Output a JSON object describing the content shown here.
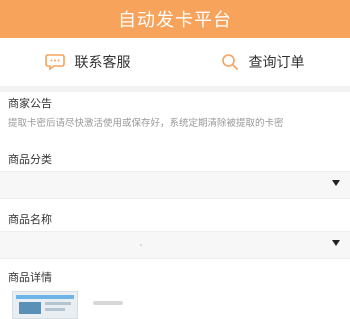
{
  "header": {
    "title": "自动发卡平台"
  },
  "actions": {
    "contact_label": "联系客服",
    "contact_icon": "chat-bubble-icon",
    "search_label": "查询订单",
    "search_icon": "search-icon",
    "accent_color": "#f7a35b"
  },
  "notice": {
    "title": "商家公告",
    "text": "提取卡密后请尽快激活使用或保存好，系统定期清除被提取的卡密"
  },
  "form": {
    "category_label": "商品分类",
    "category_value": "",
    "name_label": "商品名称",
    "name_value": "",
    "detail_label": "商品详情"
  }
}
